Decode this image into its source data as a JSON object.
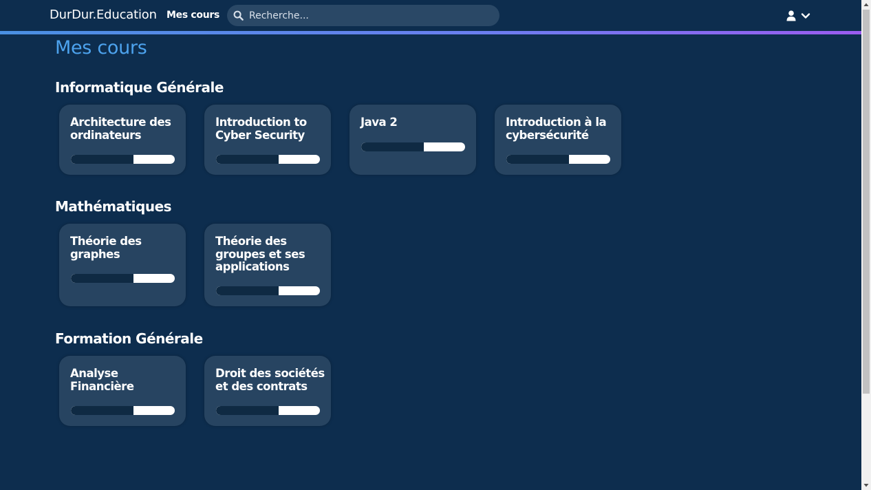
{
  "navbar": {
    "brand": "DurDur.Education",
    "nav_link": "Mes cours",
    "search_placeholder": "Recherche...",
    "search_icon": "search-icon",
    "user_icon": "user-icon",
    "dropdown_icon": "chevron-down-icon"
  },
  "colors": {
    "background": "#0d2d4e",
    "card": "#274461",
    "title_accent": "#4da3ee",
    "gradient_start": "#4a90e2",
    "gradient_end": "#9b5cf0"
  },
  "page": {
    "title": "Mes cours"
  },
  "sections": [
    {
      "title": "Informatique Générale",
      "courses": [
        {
          "title": "Architecture des ordinateurs",
          "progress": 0.6
        },
        {
          "title": "Introduction to Cyber Security",
          "progress": 0.6
        },
        {
          "title": "Java 2",
          "progress": 0.6
        },
        {
          "title": "Introduction à la cybersécurité",
          "progress": 0.6
        }
      ]
    },
    {
      "title": "Mathématiques",
      "courses": [
        {
          "title": "Théorie des graphes",
          "progress": 0.6
        },
        {
          "title": "Théorie des groupes et ses applications",
          "progress": 0.6
        }
      ]
    },
    {
      "title": "Formation Générale",
      "courses": [
        {
          "title": "Analyse Financière",
          "progress": 0.6
        },
        {
          "title": "Droit des sociétés et des contrats",
          "progress": 0.6
        }
      ]
    }
  ]
}
